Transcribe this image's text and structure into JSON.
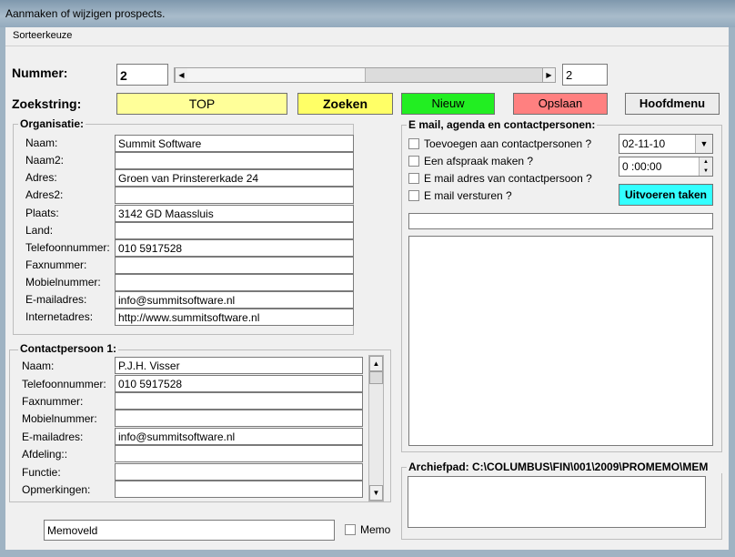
{
  "window": {
    "title": "Aanmaken of wijzigen prospects."
  },
  "menu": {
    "sort_label": "Sorteerkeuze"
  },
  "top": {
    "number_label": "Nummer:",
    "number_value": "2",
    "number_right_value": "2",
    "search_label": "Zoekstring:",
    "search_value": "TOP",
    "search_button": "Zoeken",
    "new_button": "Nieuw",
    "save_button": "Opslaan",
    "main_menu_button": "Hoofdmenu",
    "colors": {
      "search_bg": "#ffff99",
      "search_btn_bg": "#ffff66",
      "new_bg": "#22ee22",
      "save_bg": "#ff8080",
      "run_bg": "#33ffff"
    }
  },
  "org": {
    "title": "Organisatie:",
    "fields": [
      {
        "label": "Naam:",
        "value": "Summit Software"
      },
      {
        "label": "Naam2:",
        "value": ""
      },
      {
        "label": "Adres:",
        "value": "Groen van Prinstererkade 24"
      },
      {
        "label": "Adres2:",
        "value": ""
      },
      {
        "label": "Plaats:",
        "value": "3142 GD  Maassluis"
      },
      {
        "label": "Land:",
        "value": ""
      },
      {
        "label": "Telefoonnummer:",
        "value": "010 5917528"
      },
      {
        "label": "Faxnummer:",
        "value": ""
      },
      {
        "label": "Mobielnummer:",
        "value": ""
      },
      {
        "label": "E-mailadres:",
        "value": "info@summitsoftware.nl"
      },
      {
        "label": "Internetadres:",
        "value": "http://www.summitsoftware.nl"
      }
    ]
  },
  "contact": {
    "title": "Contactpersoon 1:",
    "fields": [
      {
        "label": "Naam:",
        "value": "P.J.H. Visser"
      },
      {
        "label": "Telefoonnummer:",
        "value": "010 5917528"
      },
      {
        "label": "Faxnummer:",
        "value": ""
      },
      {
        "label": "Mobielnummer:",
        "value": ""
      },
      {
        "label": "E-mailadres:",
        "value": "info@summitsoftware.nl"
      },
      {
        "label": "Afdeling::",
        "value": ""
      },
      {
        "label": "Functie:",
        "value": ""
      },
      {
        "label": "Opmerkingen:",
        "value": ""
      }
    ]
  },
  "email": {
    "title": "E mail, agenda en contactpersonen:",
    "checks": [
      "Toevoegen aan contactpersonen ?",
      "Een afspraak maken ?",
      "E mail adres van contactpersoon ?",
      "E mail versturen ?"
    ],
    "date_value": "02-11-10",
    "time_value": "0 :00:00",
    "run_button": "Uitvoeren taken"
  },
  "archive": {
    "label": "Archiefpad: C:\\COLUMBUS\\FIN\\001\\2009\\PROMEMO\\MEM"
  },
  "memo": {
    "field_value": "Memoveld",
    "check_label": "Memo"
  }
}
